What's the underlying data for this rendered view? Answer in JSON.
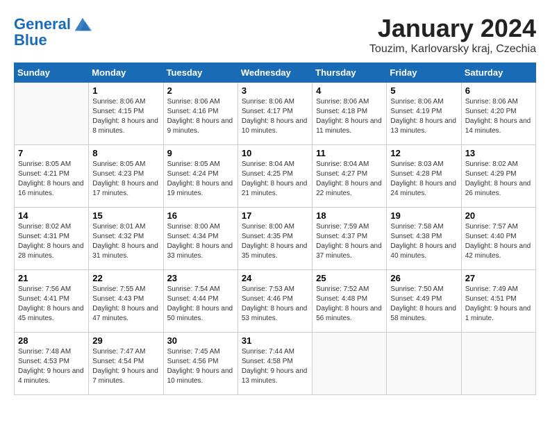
{
  "header": {
    "logo_line1": "General",
    "logo_line2": "Blue",
    "month": "January 2024",
    "location": "Touzim, Karlovarsky kraj, Czechia"
  },
  "weekdays": [
    "Sunday",
    "Monday",
    "Tuesday",
    "Wednesday",
    "Thursday",
    "Friday",
    "Saturday"
  ],
  "weeks": [
    [
      {
        "day": "",
        "sunrise": "",
        "sunset": "",
        "daylight": ""
      },
      {
        "day": "1",
        "sunrise": "Sunrise: 8:06 AM",
        "sunset": "Sunset: 4:15 PM",
        "daylight": "Daylight: 8 hours and 8 minutes."
      },
      {
        "day": "2",
        "sunrise": "Sunrise: 8:06 AM",
        "sunset": "Sunset: 4:16 PM",
        "daylight": "Daylight: 8 hours and 9 minutes."
      },
      {
        "day": "3",
        "sunrise": "Sunrise: 8:06 AM",
        "sunset": "Sunset: 4:17 PM",
        "daylight": "Daylight: 8 hours and 10 minutes."
      },
      {
        "day": "4",
        "sunrise": "Sunrise: 8:06 AM",
        "sunset": "Sunset: 4:18 PM",
        "daylight": "Daylight: 8 hours and 11 minutes."
      },
      {
        "day": "5",
        "sunrise": "Sunrise: 8:06 AM",
        "sunset": "Sunset: 4:19 PM",
        "daylight": "Daylight: 8 hours and 13 minutes."
      },
      {
        "day": "6",
        "sunrise": "Sunrise: 8:06 AM",
        "sunset": "Sunset: 4:20 PM",
        "daylight": "Daylight: 8 hours and 14 minutes."
      }
    ],
    [
      {
        "day": "7",
        "sunrise": "Sunrise: 8:05 AM",
        "sunset": "Sunset: 4:21 PM",
        "daylight": "Daylight: 8 hours and 16 minutes."
      },
      {
        "day": "8",
        "sunrise": "Sunrise: 8:05 AM",
        "sunset": "Sunset: 4:23 PM",
        "daylight": "Daylight: 8 hours and 17 minutes."
      },
      {
        "day": "9",
        "sunrise": "Sunrise: 8:05 AM",
        "sunset": "Sunset: 4:24 PM",
        "daylight": "Daylight: 8 hours and 19 minutes."
      },
      {
        "day": "10",
        "sunrise": "Sunrise: 8:04 AM",
        "sunset": "Sunset: 4:25 PM",
        "daylight": "Daylight: 8 hours and 21 minutes."
      },
      {
        "day": "11",
        "sunrise": "Sunrise: 8:04 AM",
        "sunset": "Sunset: 4:27 PM",
        "daylight": "Daylight: 8 hours and 22 minutes."
      },
      {
        "day": "12",
        "sunrise": "Sunrise: 8:03 AM",
        "sunset": "Sunset: 4:28 PM",
        "daylight": "Daylight: 8 hours and 24 minutes."
      },
      {
        "day": "13",
        "sunrise": "Sunrise: 8:02 AM",
        "sunset": "Sunset: 4:29 PM",
        "daylight": "Daylight: 8 hours and 26 minutes."
      }
    ],
    [
      {
        "day": "14",
        "sunrise": "Sunrise: 8:02 AM",
        "sunset": "Sunset: 4:31 PM",
        "daylight": "Daylight: 8 hours and 28 minutes."
      },
      {
        "day": "15",
        "sunrise": "Sunrise: 8:01 AM",
        "sunset": "Sunset: 4:32 PM",
        "daylight": "Daylight: 8 hours and 31 minutes."
      },
      {
        "day": "16",
        "sunrise": "Sunrise: 8:00 AM",
        "sunset": "Sunset: 4:34 PM",
        "daylight": "Daylight: 8 hours and 33 minutes."
      },
      {
        "day": "17",
        "sunrise": "Sunrise: 8:00 AM",
        "sunset": "Sunset: 4:35 PM",
        "daylight": "Daylight: 8 hours and 35 minutes."
      },
      {
        "day": "18",
        "sunrise": "Sunrise: 7:59 AM",
        "sunset": "Sunset: 4:37 PM",
        "daylight": "Daylight: 8 hours and 37 minutes."
      },
      {
        "day": "19",
        "sunrise": "Sunrise: 7:58 AM",
        "sunset": "Sunset: 4:38 PM",
        "daylight": "Daylight: 8 hours and 40 minutes."
      },
      {
        "day": "20",
        "sunrise": "Sunrise: 7:57 AM",
        "sunset": "Sunset: 4:40 PM",
        "daylight": "Daylight: 8 hours and 42 minutes."
      }
    ],
    [
      {
        "day": "21",
        "sunrise": "Sunrise: 7:56 AM",
        "sunset": "Sunset: 4:41 PM",
        "daylight": "Daylight: 8 hours and 45 minutes."
      },
      {
        "day": "22",
        "sunrise": "Sunrise: 7:55 AM",
        "sunset": "Sunset: 4:43 PM",
        "daylight": "Daylight: 8 hours and 47 minutes."
      },
      {
        "day": "23",
        "sunrise": "Sunrise: 7:54 AM",
        "sunset": "Sunset: 4:44 PM",
        "daylight": "Daylight: 8 hours and 50 minutes."
      },
      {
        "day": "24",
        "sunrise": "Sunrise: 7:53 AM",
        "sunset": "Sunset: 4:46 PM",
        "daylight": "Daylight: 8 hours and 53 minutes."
      },
      {
        "day": "25",
        "sunrise": "Sunrise: 7:52 AM",
        "sunset": "Sunset: 4:48 PM",
        "daylight": "Daylight: 8 hours and 56 minutes."
      },
      {
        "day": "26",
        "sunrise": "Sunrise: 7:50 AM",
        "sunset": "Sunset: 4:49 PM",
        "daylight": "Daylight: 8 hours and 58 minutes."
      },
      {
        "day": "27",
        "sunrise": "Sunrise: 7:49 AM",
        "sunset": "Sunset: 4:51 PM",
        "daylight": "Daylight: 9 hours and 1 minute."
      }
    ],
    [
      {
        "day": "28",
        "sunrise": "Sunrise: 7:48 AM",
        "sunset": "Sunset: 4:53 PM",
        "daylight": "Daylight: 9 hours and 4 minutes."
      },
      {
        "day": "29",
        "sunrise": "Sunrise: 7:47 AM",
        "sunset": "Sunset: 4:54 PM",
        "daylight": "Daylight: 9 hours and 7 minutes."
      },
      {
        "day": "30",
        "sunrise": "Sunrise: 7:45 AM",
        "sunset": "Sunset: 4:56 PM",
        "daylight": "Daylight: 9 hours and 10 minutes."
      },
      {
        "day": "31",
        "sunrise": "Sunrise: 7:44 AM",
        "sunset": "Sunset: 4:58 PM",
        "daylight": "Daylight: 9 hours and 13 minutes."
      },
      {
        "day": "",
        "sunrise": "",
        "sunset": "",
        "daylight": ""
      },
      {
        "day": "",
        "sunrise": "",
        "sunset": "",
        "daylight": ""
      },
      {
        "day": "",
        "sunrise": "",
        "sunset": "",
        "daylight": ""
      }
    ]
  ]
}
